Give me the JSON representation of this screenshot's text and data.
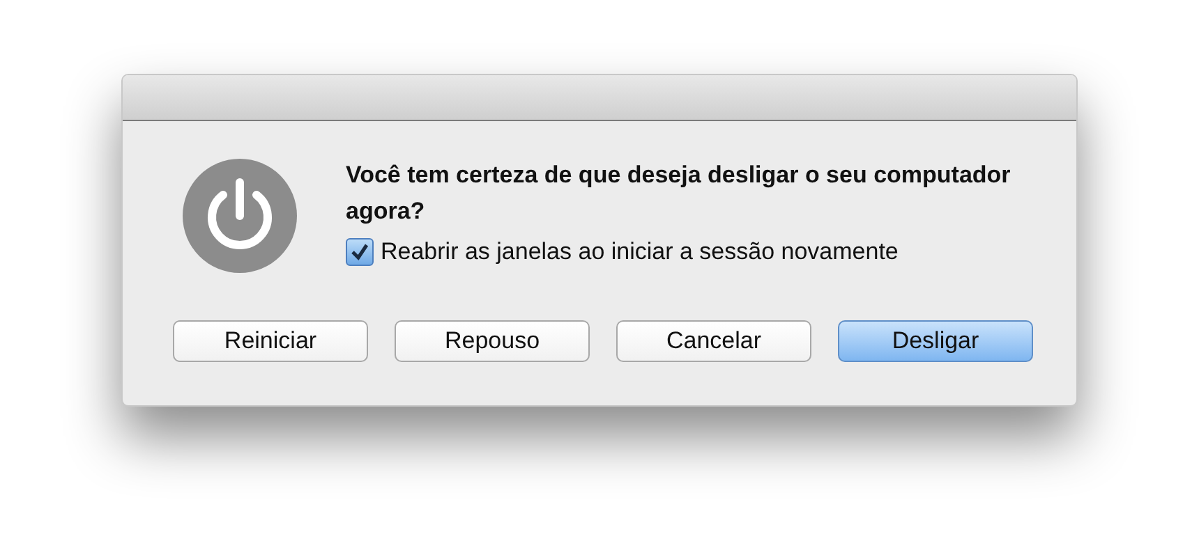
{
  "dialog": {
    "message": "Você tem certeza de que deseja desligar o seu computador agora?",
    "checkbox": {
      "label": "Reabrir as janelas ao iniciar a sessão novamente",
      "checked": true
    },
    "buttons": [
      {
        "label": "Reiniciar",
        "default": false
      },
      {
        "label": "Repouso",
        "default": false
      },
      {
        "label": "Cancelar",
        "default": false
      },
      {
        "label": "Desligar",
        "default": true
      }
    ]
  }
}
